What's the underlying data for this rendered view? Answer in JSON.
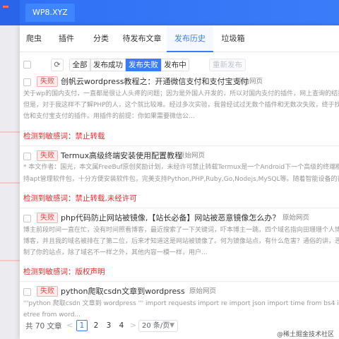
{
  "window": {
    "tab_title": "WP8.XYZ"
  },
  "tabs": [
    {
      "label": "爬虫"
    },
    {
      "label": "插件"
    },
    {
      "label": "分类"
    },
    {
      "label": "待发布文章"
    },
    {
      "label": "发布历史"
    },
    {
      "label": "垃圾箱"
    }
  ],
  "active_tab": "发布历史",
  "toolbar": {
    "filters": [
      "全部",
      "发布成功",
      "发布失败",
      "发布中"
    ],
    "active_filter": "发布失败",
    "republish_label": "重新发布",
    "refresh_icon": "refresh-icon"
  },
  "items": [
    {
      "status": "失败",
      "title": "创帆云wordpress教程之：开通微信支付和支付宝支付",
      "source": "原始网页",
      "desc_lines": [
        "关于wp的国内支付，一直都是很让人头疼的问题；因为是外国人开发的，所以对国内支付的插件，网上查询的结果是需要",
        "但是，对于我这样不了解PHP的人，这个就比较难。经过多次实验，我曾经试过无数个插件和无数次失败，终于找到了一",
        "信和支付宝支付的插件。用插件的前提：你如果需要微信公..."
      ],
      "warning": "检测到敏感词：禁止转载"
    },
    {
      "status": "失败",
      "title": "Termux高级终端安装使用配置教程",
      "source": "原始网页",
      "desc_lines": [
        "* 本文作者：国光，本文属FreeBuf原创奖励计划，未经许可禁止转载Termux是一个Android下一个高级的终端模拟器，开",
        "持apt管理软件包，十分方便安装软件包，完美支持Python,PHP,Ruby,Go,Nodejs,MySQL等。随着智能设备的普及和性能的"
      ],
      "warning": "检测到敏感词：禁止转载,未经许可"
    },
    {
      "status": "失败",
      "title": "php代码防止网站被镜像,【站长必备】网站被恶意镜像怎么办？",
      "source": "原始网页",
      "desc_lines": [
        "博主前段时间一直在忙，没有时间照看博客，最近搜索了一下关键词，吓本博主一跳，四个域名指向田珊珊个人博客网站",
        "博客，并且我的域名被排在了第二位，后来才知道这是网站被镜像了。何为镜像站点，有什么危害？通俗的讲，恶意镜像",
        "制了你的站点，除了域名不一样之外，其他内容一模一样，用户..."
      ],
      "warning": "检测到敏感词：版权声明"
    },
    {
      "status": "失败",
      "title": "python爬取csdn文章到wordpress",
      "source": "原始网页",
      "desc_lines": [
        "'''python 爬取csdn 文章到 wordpress ''' import requests import re import json import time from bs4 import BeautifulSou",
        "etree from word..."
      ],
      "warning": ""
    }
  ],
  "pagination": {
    "total": "共 70 文章",
    "prev": "<",
    "pages": [
      "1",
      "2",
      "3",
      "4"
    ],
    "current": "1",
    "next": ">",
    "page_size": "20 条/页"
  },
  "watermark": "@稀土掘金技术社区",
  "colors": {
    "accent": "#3a7cf8",
    "danger": "#e02d2d",
    "topbar": "#2f6ff5"
  }
}
